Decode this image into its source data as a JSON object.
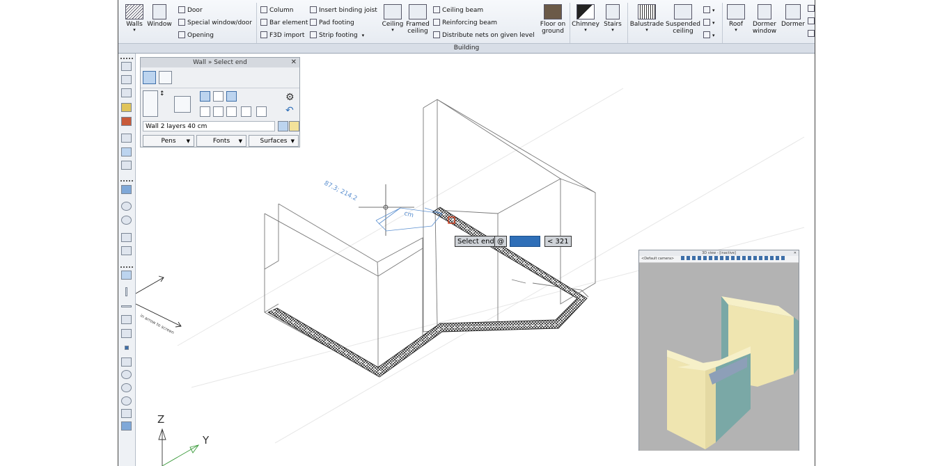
{
  "ribbon": {
    "group_label": "Building",
    "walls": "Walls",
    "window": "Window",
    "door": "Door",
    "special_window": "Special window/door",
    "opening": "Opening",
    "column": "Column",
    "bar_element": "Bar element",
    "f3d_import": "F3D import",
    "insert_binding_joist": "Insert binding joist",
    "pad_footing": "Pad footing",
    "strip_footing": "Strip footing",
    "ceiling": "Ceiling",
    "framed_ceiling": "Framed ceiling",
    "ceiling_beam": "Ceiling beam",
    "reinforcing_beam": "Reinforcing beam",
    "distribute_nets": "Distribute nets on given level",
    "floor_on_ground": "Floor on ground",
    "chimney": "Chimney",
    "stairs": "Stairs",
    "balustrade": "Balustrade",
    "suspended_ceiling": "Suspended ceiling",
    "roof": "Roof",
    "dormer_window": "Dormer window",
    "dormer": "Dormer"
  },
  "panel": {
    "title": "Wall » Select end",
    "wall_type": "Wall 2 layers 40 cm",
    "pens": "Pens",
    "fonts": "Fonts",
    "surfaces": "Surfaces"
  },
  "tooltip": {
    "label": "Select end",
    "at": "@",
    "angle": "< 321"
  },
  "view3d": {
    "title": "3D view - [inactive]",
    "camera": "<Default camera>"
  },
  "canvas": {
    "dim_text": "87.3; 214.2",
    "dim_cm": "cm",
    "arrow_text": "in arrow to screen",
    "axis_z": "Z",
    "axis_y": "Y"
  },
  "colors": {
    "wall_fill": "#4a4a4a",
    "model_yellow": "#f2e9b8",
    "model_teal": "#7aa8a6",
    "dim_blue": "#5a8fd0",
    "marker_red": "#d03a1a"
  }
}
